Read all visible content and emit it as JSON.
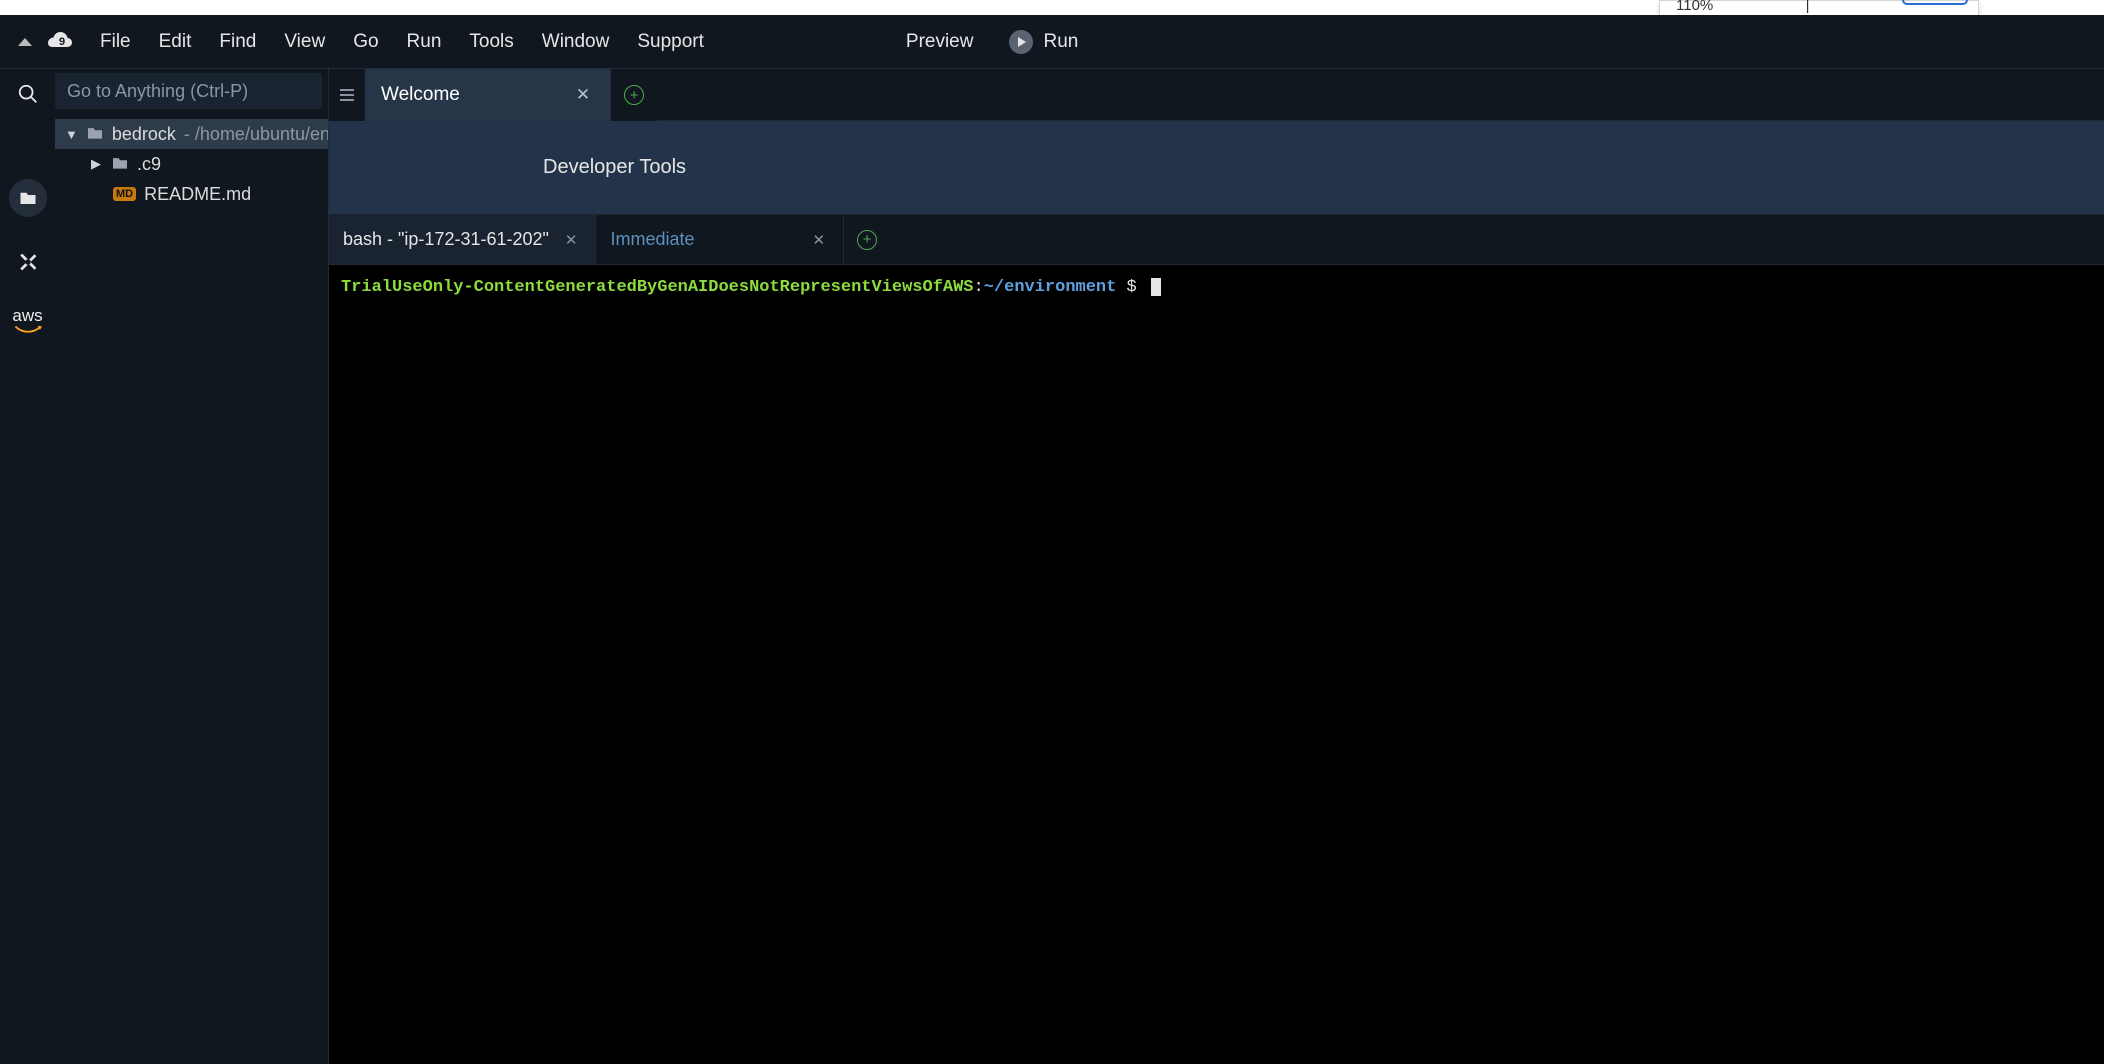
{
  "top_widget": {
    "left_fragment": "110%",
    "divider": "|"
  },
  "menubar": {
    "items": [
      "File",
      "Edit",
      "Find",
      "View",
      "Go",
      "Run",
      "Tools",
      "Window",
      "Support"
    ],
    "preview_label": "Preview",
    "run_label": "Run"
  },
  "goto_placeholder": "Go to Anything (Ctrl-P)",
  "tree": {
    "root": {
      "name": "bedrock",
      "path_suffix": " - /home/ubuntu/environment"
    },
    "children": [
      {
        "type": "folder",
        "name": ".c9",
        "expanded": false
      },
      {
        "type": "file",
        "name": "README.md",
        "badge": "MD"
      }
    ]
  },
  "editor_tabs": {
    "active": {
      "label": "Welcome"
    }
  },
  "dev_banner": "Developer Tools",
  "terminal_tabs": {
    "items": [
      {
        "label": "bash - \"ip-172-31-61-202\"",
        "active": true
      },
      {
        "label": "Immediate",
        "active": false
      }
    ]
  },
  "terminal": {
    "prompt_user": "TrialUseOnly-ContentGeneratedByGenAIDoesNotRepresentViewsOfAWS",
    "prompt_colon": ":",
    "prompt_path": "~/environment",
    "prompt_dollar": " $ "
  },
  "icons": {
    "search": "search-icon",
    "folder": "folder-icon",
    "git": "git-icon",
    "aws": "aws"
  }
}
